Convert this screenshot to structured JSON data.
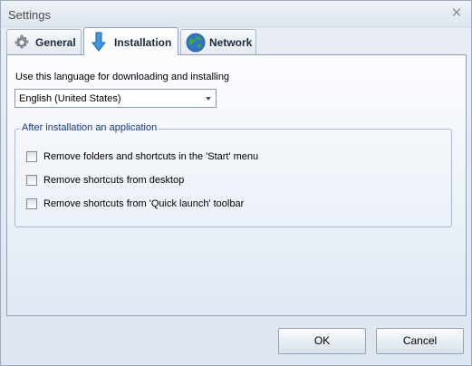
{
  "window": {
    "title": "Settings",
    "close_glyph": "✕"
  },
  "tabs": [
    {
      "label": "General",
      "icon": "gear-icon",
      "selected": false
    },
    {
      "label": "Installation",
      "icon": "download-arrow-icon",
      "selected": true
    },
    {
      "label": "Network",
      "icon": "globe-icon",
      "selected": false
    }
  ],
  "installation": {
    "language_label": "Use this language for downloading and installing",
    "language_value": "English (United States)",
    "group_title": "After installation an application",
    "options": [
      {
        "label": "Remove folders and shortcuts in the 'Start' menu",
        "checked": false
      },
      {
        "label": "Remove shortcuts from desktop",
        "checked": false
      },
      {
        "label": "Remove shortcuts from 'Quick launch' toolbar",
        "checked": false
      }
    ]
  },
  "buttons": {
    "ok": "OK",
    "cancel": "Cancel"
  },
  "colors": {
    "accent": "#163b83",
    "border": "#8da2bf"
  }
}
